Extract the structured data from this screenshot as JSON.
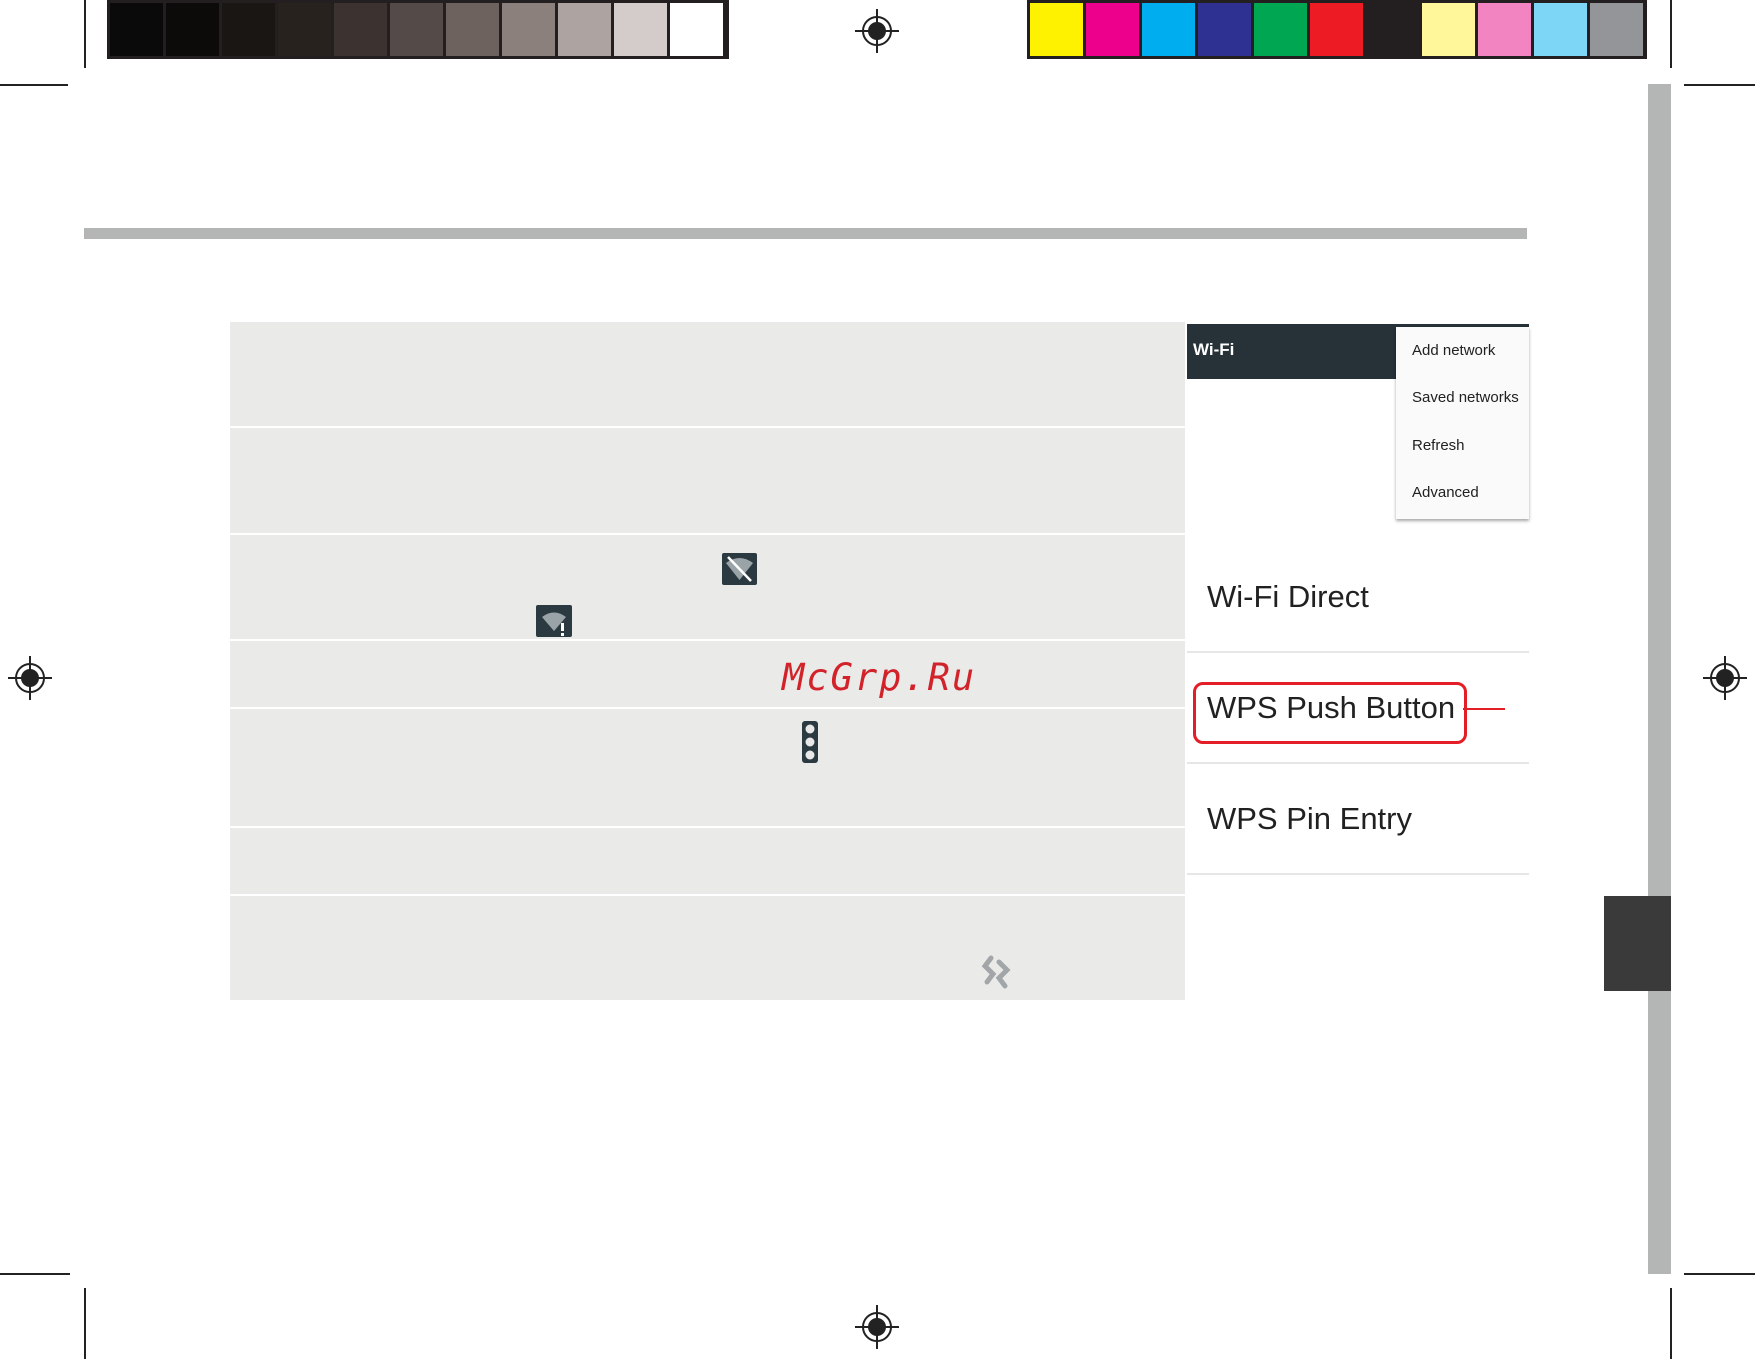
{
  "color_bars": {
    "grayscale": [
      "#0a0a0a",
      "#0d0b0a",
      "#1a1614",
      "#28221f",
      "#3c3330",
      "#544a47",
      "#6e625f",
      "#8c807d",
      "#ada3a0",
      "#d4cccb",
      "#ffffff"
    ],
    "process": [
      "#fff200",
      "#ec008c",
      "#00aeef",
      "#2e3192",
      "#00a651",
      "#ed1c24",
      "#231f20",
      "#fff799",
      "#f384c2",
      "#7dd6f5",
      "#939598"
    ]
  },
  "wifi_screen": {
    "title": "Wi-Fi",
    "menu_items": [
      "Add network",
      "Saved networks",
      "Refresh",
      "Advanced"
    ],
    "options": [
      "Wi-Fi Direct",
      "WPS Push Button",
      "WPS Pin Entry"
    ],
    "highlight_color": "#e41e26"
  },
  "icons": {
    "wifi_off": "wifi-off-icon",
    "wifi_warning": "wifi-warning-icon",
    "overflow_menu": "three-dot-menu-icon",
    "wps": "wps-icon"
  },
  "watermark": "McGrp.Ru"
}
